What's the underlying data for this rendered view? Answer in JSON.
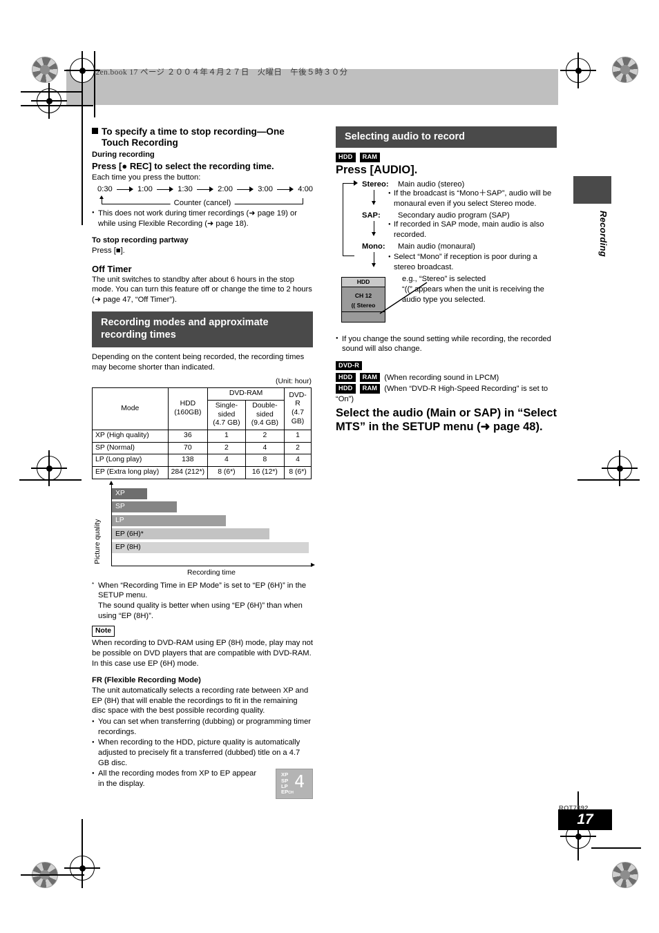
{
  "book_header": "7392en.book  17 ページ  ２００４年４月２７日　火曜日　午後５時３０分",
  "side_tab_label": "Recording",
  "footer": {
    "code": "RQT7392",
    "page_number": "17"
  },
  "left_column": {
    "heading": "To specify a time to stop recording—One Touch Recording",
    "during_recording": "During recording",
    "press_rec": "Press [● REC] to select the recording time.",
    "each_time": "Each time you press the button:",
    "time_sequence": [
      "0:30",
      "1:00",
      "1:30",
      "2:00",
      "3:00",
      "4:00"
    ],
    "counter_label": "Counter (cancel)",
    "bullet_timer": "This does not work during timer recordings (➜ page 19) or while using Flexible Recording (➜ page 18).",
    "stop_partway_title": "To stop recording partway",
    "stop_partway_text": "Press [■].",
    "off_timer_title": "Off Timer",
    "off_timer_text": "The unit switches to standby after about 6 hours in the stop mode. You can turn this feature off or change the time to 2 hours (➜ page 47, “Off Timer”).",
    "section_title": "Recording modes and approximate recording times",
    "section_intro": "Depending on the content being recorded, the recording times may become shorter than indicated.",
    "unit_note": "(Unit: hour)",
    "table": {
      "headers": {
        "mode": "Mode",
        "hdd": "HDD",
        "hdd_sub": "(160GB)",
        "dvdram": "DVD-RAM",
        "single": "Single-",
        "single2": "sided",
        "single3": "(4.7 GB)",
        "double": "Double-",
        "double2": "sided",
        "double3": "(9.4 GB)",
        "dvdr": "DVD-",
        "dvdr2": "R",
        "dvdr3": "(4.7",
        "dvdr4": "GB)"
      },
      "rows": [
        {
          "mode": "XP (High quality)",
          "hdd": "36",
          "single": "1",
          "double": "2",
          "dvdr": "1"
        },
        {
          "mode": "SP (Normal)",
          "hdd": "70",
          "single": "2",
          "double": "4",
          "dvdr": "2"
        },
        {
          "mode": "LP (Long play)",
          "hdd": "138",
          "single": "4",
          "double": "8",
          "dvdr": "4"
        },
        {
          "mode": "EP (Extra long play)",
          "hdd": "284 (212*)",
          "single": "8 (6*)",
          "double": "16 (12*)",
          "dvdr": "8 (6*)"
        }
      ]
    },
    "chart_footnote": "When “Recording Time in EP Mode” is set to “EP (6H)” in the SETUP menu.",
    "chart_footnote2": "The sound quality is better when using “EP (6H)” than when using “EP (8H)”.",
    "note_badge": "Note",
    "note_text": "When recording to DVD-RAM using EP (8H) mode, play may not be possible on DVD players that are compatible with DVD-RAM. In this case use EP (6H) mode.",
    "fr_title": "FR (Flexible Recording Mode)",
    "fr_text": "The unit automatically selects a recording rate between XP and EP (8H) that will enable the recordings to fit in the remaining disc space with the best possible recording quality.",
    "fr_bullets": [
      "You can set when transferring (dubbing) or programming timer recordings.",
      "When recording to the HDD, picture quality is automatically adjusted to precisely fit a transferred (dubbed) title on a 4.7 GB disc.",
      "All the recording modes from XP to EP appear in the display."
    ],
    "fr_display": {
      "modes": [
        "XP",
        "SP",
        "LP",
        "EP"
      ],
      "ch": "CH",
      "segment": "4"
    }
  },
  "chart_data": {
    "type": "bar",
    "title": "",
    "xlabel": "Recording time",
    "ylabel": "Picture quality",
    "categories": [
      "XP",
      "SP",
      "LP",
      "EP (6H)*",
      "EP (8H)"
    ],
    "values": [
      18,
      33,
      58,
      80,
      100
    ],
    "colors": [
      "#6e6e6e",
      "#858585",
      "#9e9e9e",
      "#c3c3c3",
      "#d4d4d4"
    ],
    "label_colors": [
      "#ffffff",
      "#ffffff",
      "#ffffff",
      "#000000",
      "#000000"
    ],
    "xlim": [
      0,
      100
    ],
    "grid": false,
    "legend": "none",
    "orientation": "horizontal"
  },
  "right_column": {
    "section_title": "Selecting audio to record",
    "badges_top": [
      "HDD",
      "RAM"
    ],
    "press_audio": "Press [AUDIO].",
    "audio_modes": [
      {
        "label": "Stereo:",
        "text": "Main audio (stereo)",
        "bullet": "If the broadcast is “Mono＋SAP”, audio will be monaural even if you select Stereo mode."
      },
      {
        "label": "SAP:",
        "text": "Secondary audio program (SAP)",
        "bullet": "If recorded in SAP mode, main audio is also recorded."
      },
      {
        "label": "Mono:",
        "text": "Main audio (monaural)",
        "bullet": "Select “Mono” if reception is poor during a stereo broadcast."
      }
    ],
    "display_example": {
      "caption": "e.g., “Stereo” is selected",
      "explanation": "“((” appears when the unit is receiving the audio type you selected.",
      "box": {
        "title": "HDD",
        "channel": "CH 12",
        "status": "(( Stereo"
      }
    },
    "bullet_change": "If you change the sound setting while recording, the recorded sound will also change.",
    "dvdr_badge": "DVD-R",
    "lpcm_badges": [
      "HDD",
      "RAM"
    ],
    "lpcm_text": "(When recording sound in LPCM)",
    "highspeed_badges": [
      "HDD",
      "RAM"
    ],
    "highspeed_text": "(When “DVD-R High-Speed Recording” is set to “On”)",
    "select_audio_statement": "Select the audio (Main or SAP) in “Select MTS” in the SETUP menu (➜ page 48)."
  }
}
